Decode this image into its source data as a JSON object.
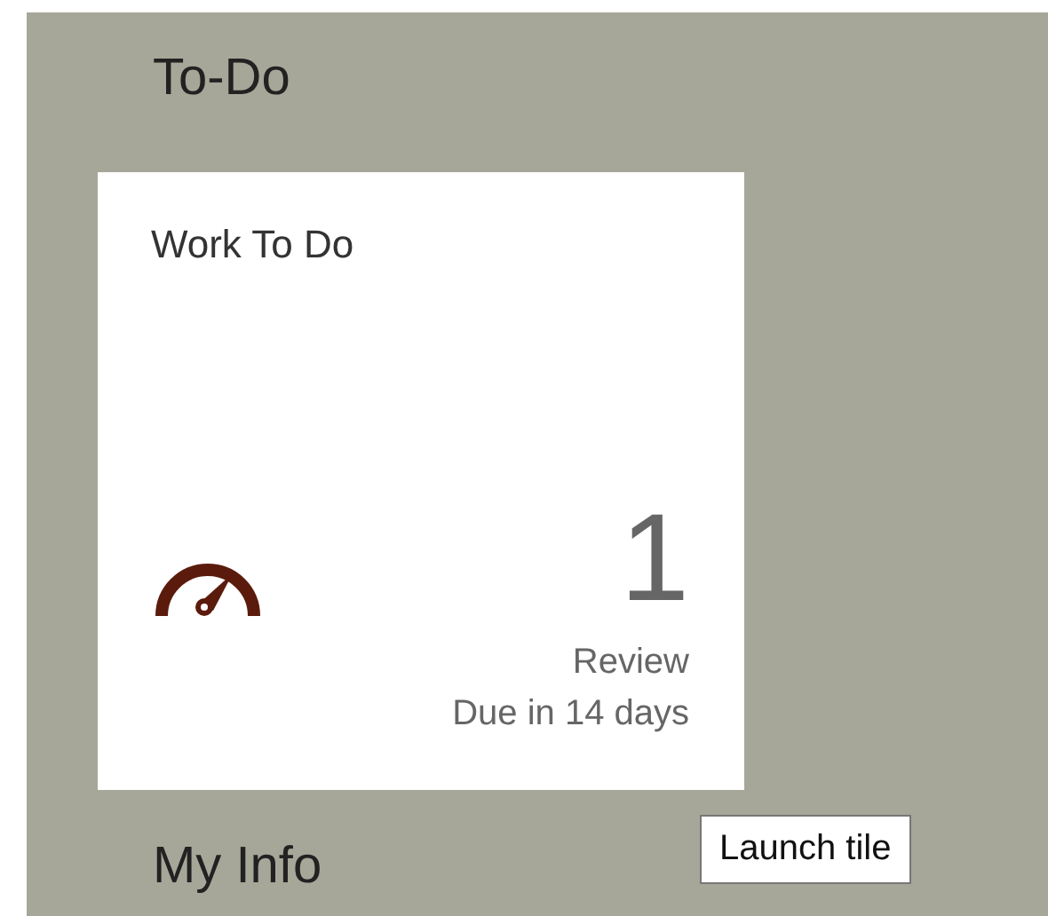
{
  "sections": [
    {
      "title": "To-Do",
      "tiles": [
        {
          "title": "Work To Do",
          "count": "1",
          "label": "Review",
          "due": "Due in 14 days"
        }
      ]
    },
    {
      "title": "My Info"
    }
  ],
  "tooltip": "Launch tile"
}
